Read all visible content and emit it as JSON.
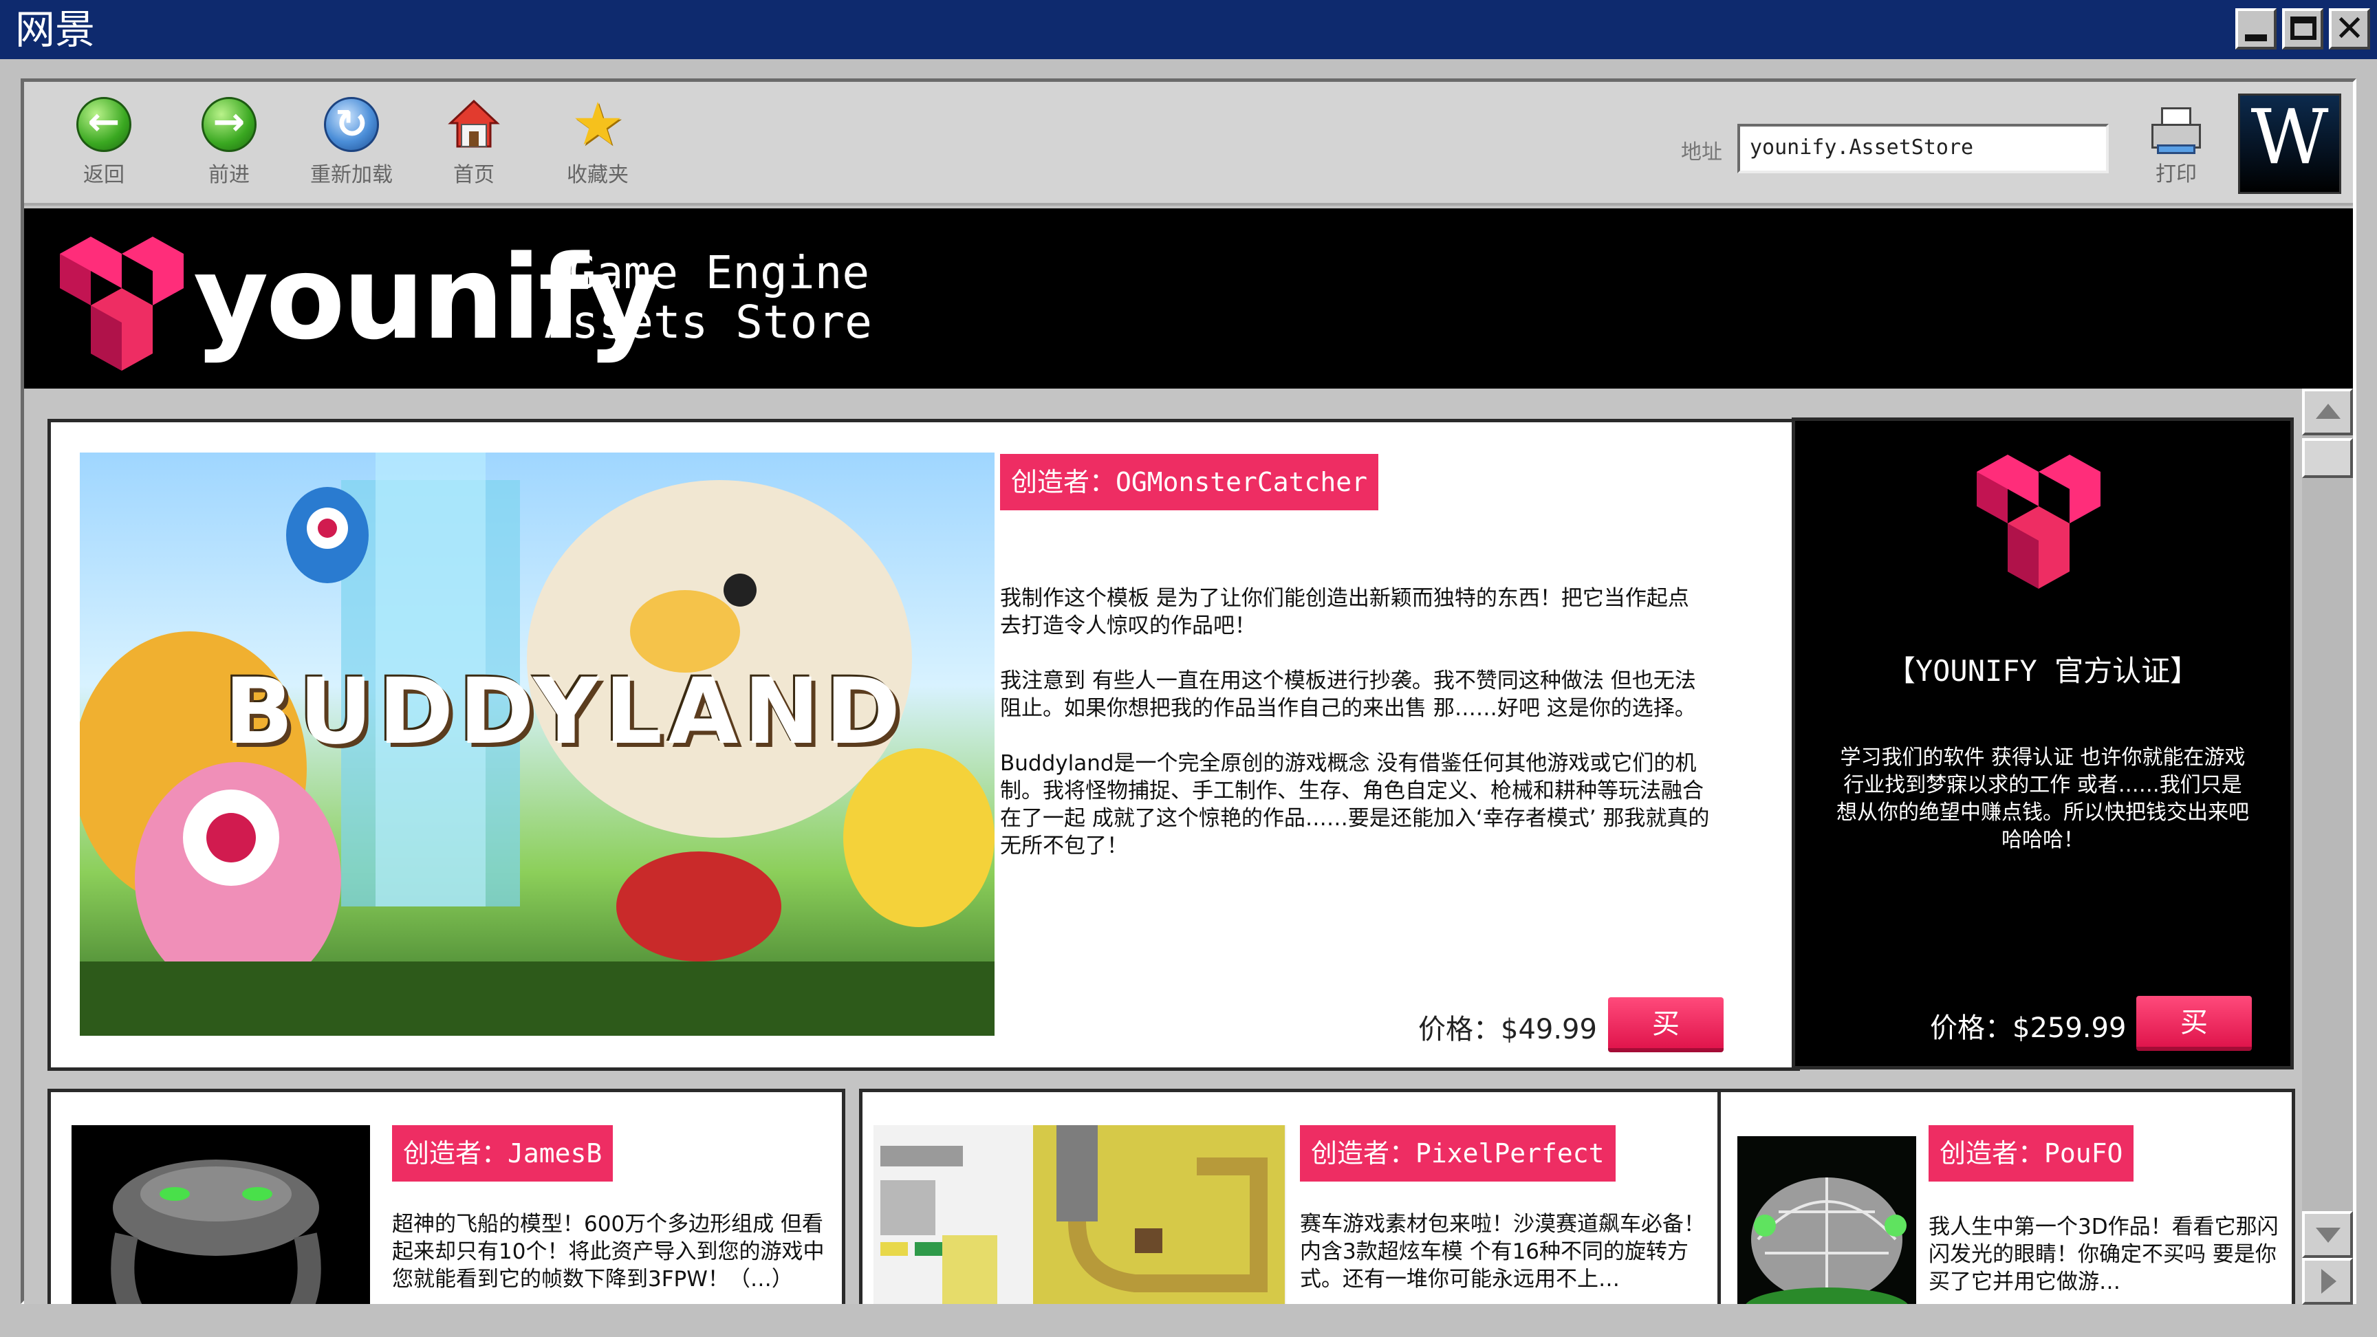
{
  "window": {
    "title": "网景"
  },
  "toolbar": {
    "back": "返回",
    "forward": "前进",
    "reload": "重新加载",
    "home": "首页",
    "favorites": "收藏夹",
    "address_label": "地址",
    "address_value": "younify.AssetStore",
    "print": "打印",
    "logo_letter": "W"
  },
  "site": {
    "brand": "younify",
    "tagline_1": "Game Engine",
    "tagline_2": "Assets Store",
    "accent": "#ee2d63"
  },
  "featured": {
    "image_title": "BUDDYLAND",
    "creator": "创造者：OGMonsterCatcher",
    "paragraphs": [
      "我制作这个模板 是为了让你们能创造出新颖而独特的东西！把它当作起点 去打造令人惊叹的作品吧！",
      "我注意到 有些人一直在用这个模板进行抄袭。我不赞同这种做法 但也无法阻止。如果你想把我的作品当作自己的来出售 那……好吧 这是你的选择。",
      "Buddyland是一个完全原创的游戏概念 没有借鉴任何其他游戏或它们的机制。我将怪物捕捉、手工制作、生存、角色自定义、枪械和耕种等玩法融合在了一起 成就了这个惊艳的作品……要是还能加入‘幸存者模式’ 那我就真的无所不包了！"
    ],
    "price": "价格：$49.99",
    "buy": "买"
  },
  "official": {
    "title": "【YOUNIFY 官方认证】",
    "desc": "学习我们的软件 获得认证 也许你就能在游戏行业找到梦寐以求的工作 或者……我们只是想从你的绝望中赚点钱。所以快把钱交出来吧哈哈哈！",
    "price": "价格：$259.99",
    "buy": "买"
  },
  "items": [
    {
      "creator": "创造者：JamesB",
      "desc": "超神的飞船的模型！600万个多边形组成 但看起来却只有10个！将此资产导入到您的游戏中 您就能看到它的帧数下降到3FPW！（…）"
    },
    {
      "creator": "创造者：PixelPerfect",
      "desc": "赛车游戏素材包来啦！沙漠赛道飙车必备！内含3款超炫车模 个有16种不同的旋转方式。还有一堆你可能永远用不上…"
    },
    {
      "creator": "创造者：PouFO",
      "desc": "我人生中第一个3D作品！看看它那闪闪发光的眼睛！你确定不买吗 要是你买了它并用它做游…"
    }
  ]
}
